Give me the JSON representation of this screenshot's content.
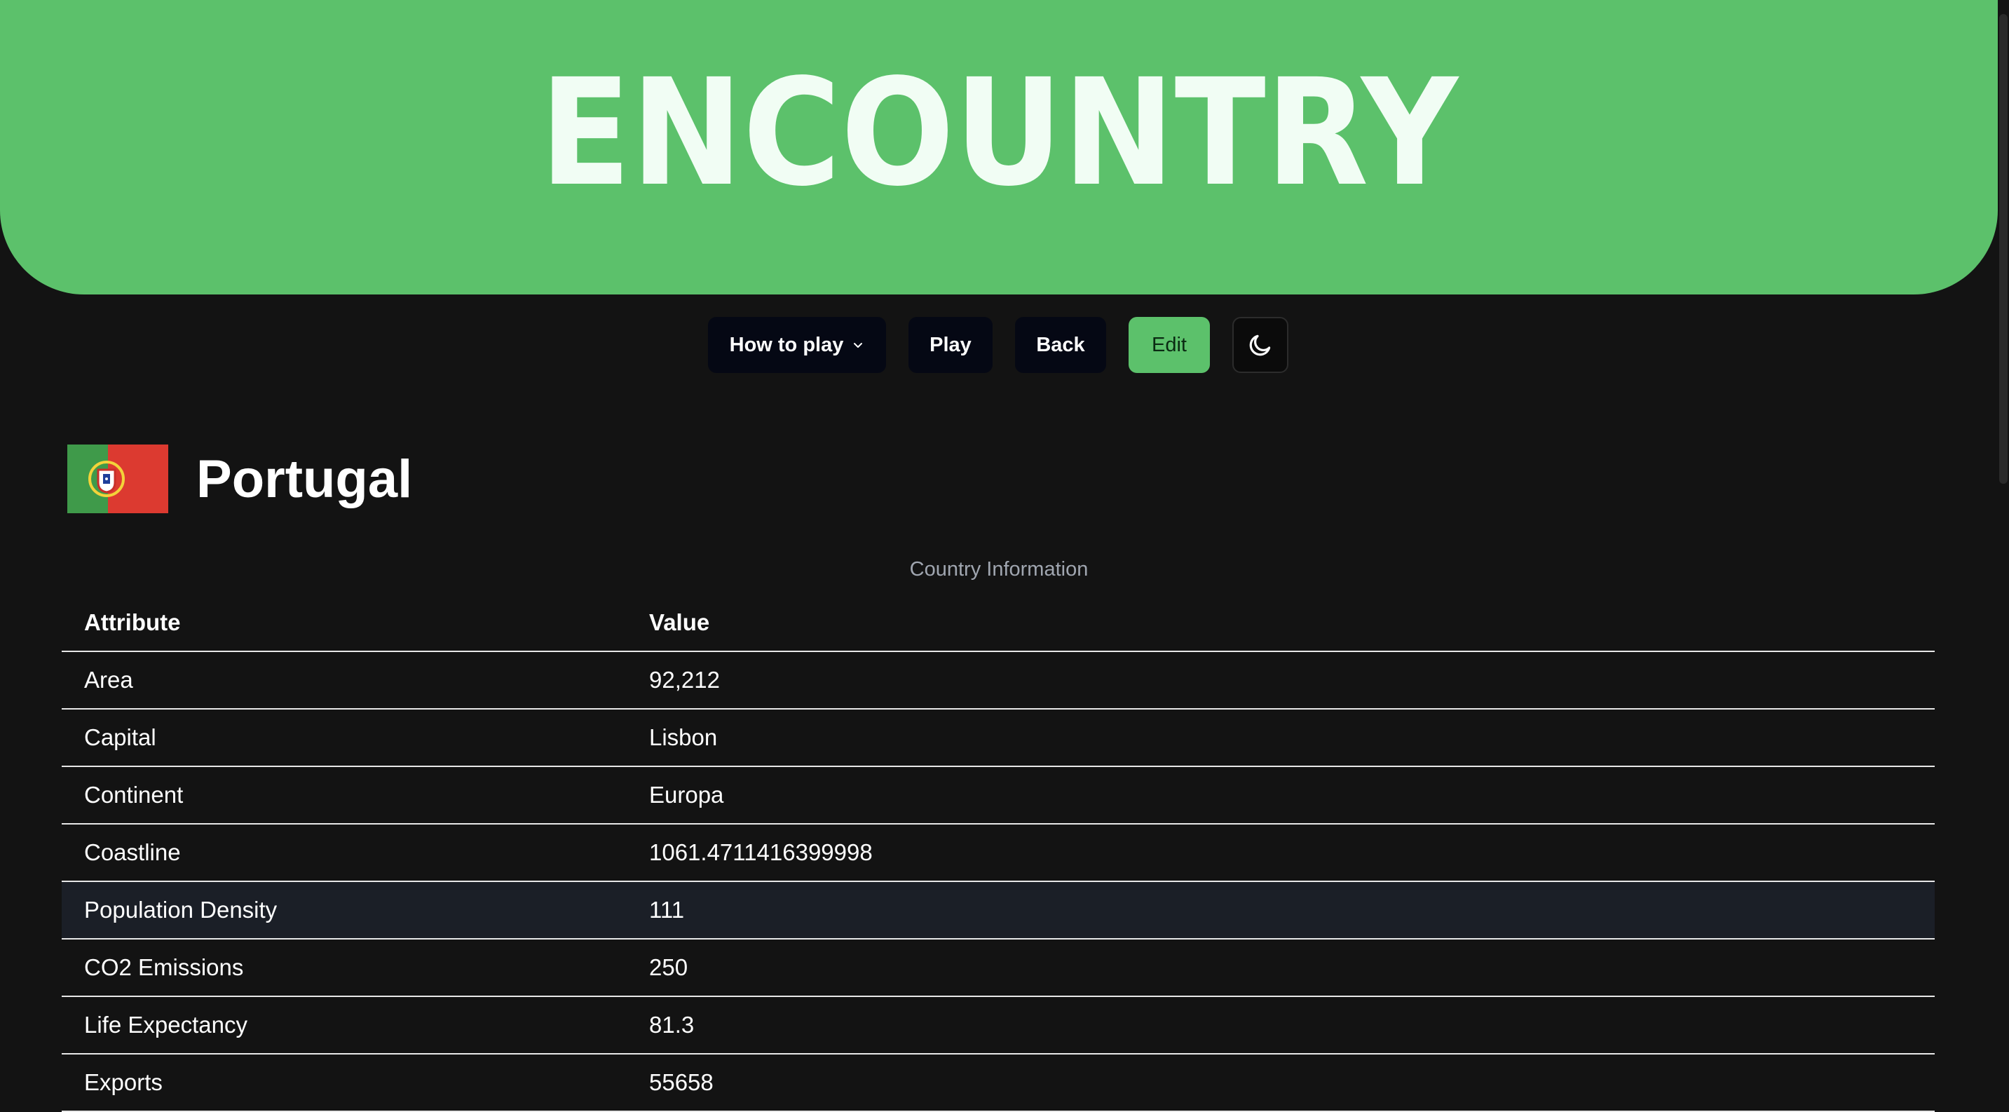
{
  "app": {
    "title": "ENCOUNTRY"
  },
  "nav": {
    "how_to_play": "How to play",
    "play": "Play",
    "back": "Back",
    "edit": "Edit",
    "theme_icon": "moon-icon",
    "dropdown_icon": "chevron-down-icon"
  },
  "country": {
    "name": "Portugal",
    "flag_icon": "portugal-flag"
  },
  "table": {
    "caption": "Country Information",
    "headers": [
      "Attribute",
      "Value"
    ],
    "rows": [
      {
        "attribute": "Area",
        "value": "92,212"
      },
      {
        "attribute": "Capital",
        "value": "Lisbon"
      },
      {
        "attribute": "Continent",
        "value": "Europa"
      },
      {
        "attribute": "Coastline",
        "value": "1061.4711416399998"
      },
      {
        "attribute": "Population Density",
        "value": "111"
      },
      {
        "attribute": "CO2 Emissions",
        "value": "250"
      },
      {
        "attribute": "Life Expectancy",
        "value": "81.3"
      },
      {
        "attribute": "Exports",
        "value": "55658"
      }
    ]
  },
  "colors": {
    "brand_green": "#5cc16b",
    "background": "#131313",
    "logo_fill": "#f1fdf4",
    "flag_green": "#3f9a4a",
    "flag_red": "#dc3a30"
  }
}
